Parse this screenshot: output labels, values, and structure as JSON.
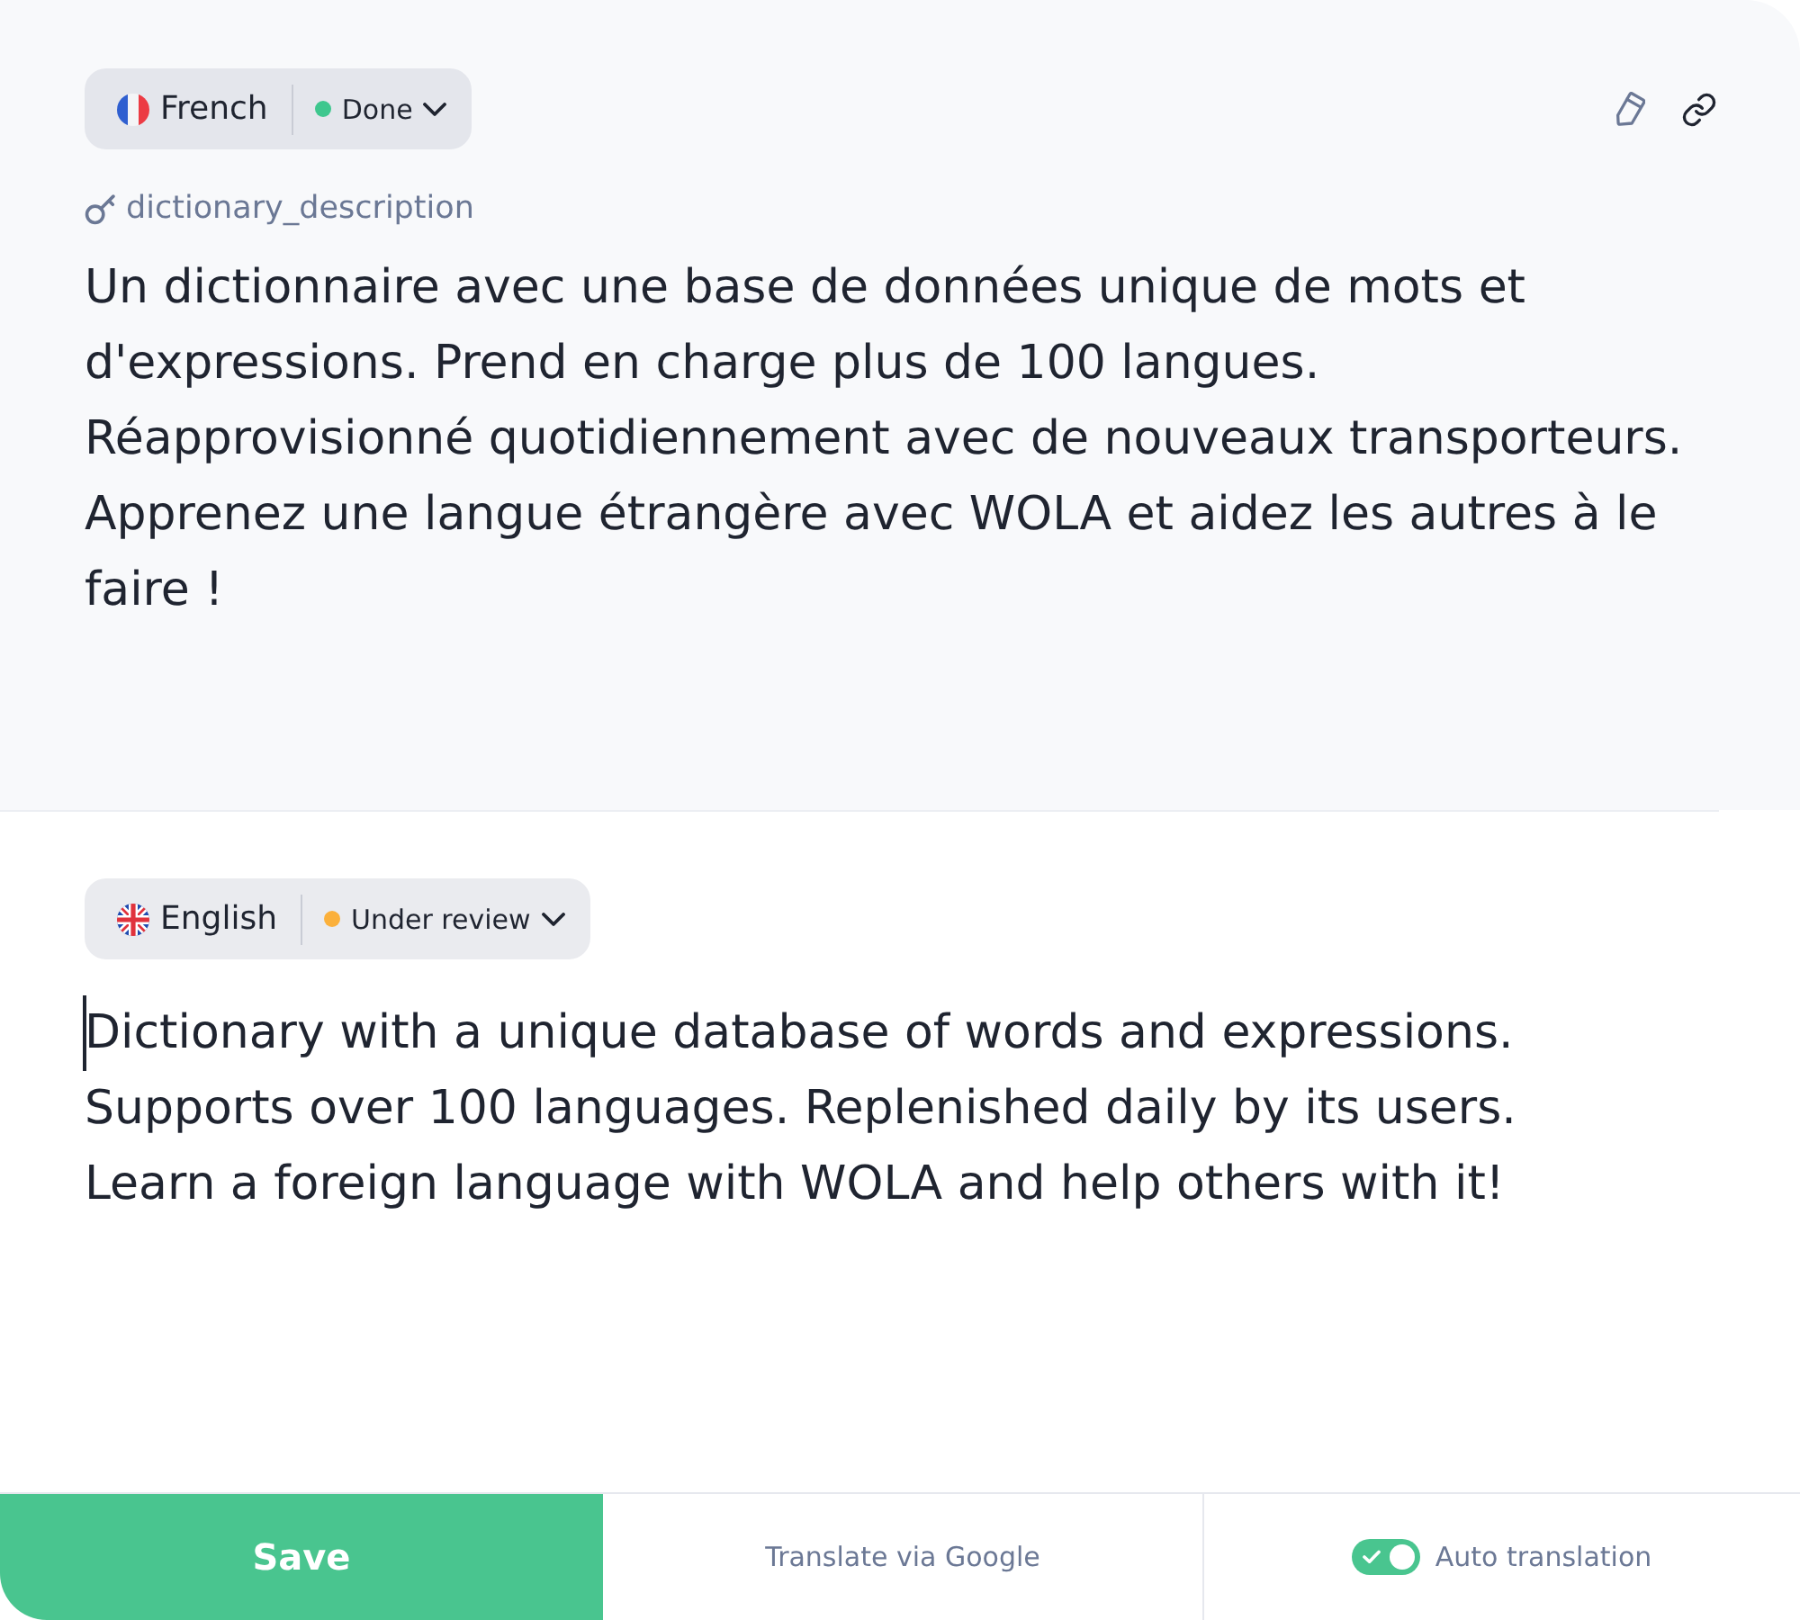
{
  "source": {
    "language": "French",
    "status": {
      "label": "Done",
      "color": "#3ec78e"
    },
    "key": "dictionary_description",
    "text": "Un dictionnaire avec une base de données unique de mots et d'expressions. Prend en charge plus de 100 langues. Réapprovisionné quotidiennement avec de nouveaux transporteurs. Apprenez une langue étrangère avec WOLA et aidez les autres à le faire !"
  },
  "target": {
    "language": "English",
    "status": {
      "label": "Under review",
      "color": "#fbb03b"
    },
    "editor": {
      "value": "Dictionary with a unique database of words and expressions.\nSupports over 100 languages. Replenished daily by its users.\nLearn a foreign language with WOLA and help others with it!",
      "focused": true
    }
  },
  "footer": {
    "save_button": "Save",
    "google_button": "Translate via Google",
    "auto_translation": {
      "label": "Auto translation",
      "on": true
    }
  }
}
